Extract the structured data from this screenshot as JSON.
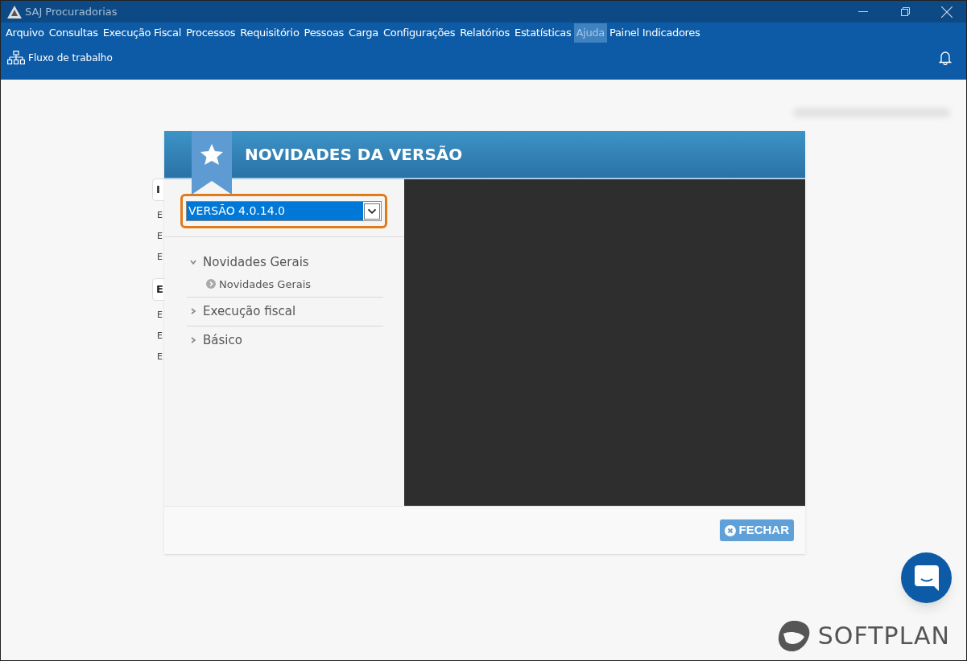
{
  "window": {
    "title": "SAJ Procuradorias"
  },
  "menu": [
    {
      "label": "Arquivo",
      "selected": false
    },
    {
      "label": "Consultas",
      "selected": false
    },
    {
      "label": "Execução Fiscal",
      "selected": false
    },
    {
      "label": "Processos",
      "selected": false
    },
    {
      "label": "Requisitório",
      "selected": false
    },
    {
      "label": "Pessoas",
      "selected": false
    },
    {
      "label": "Carga",
      "selected": false
    },
    {
      "label": "Configurações",
      "selected": false
    },
    {
      "label": "Relatórios",
      "selected": false
    },
    {
      "label": "Estatísticas",
      "selected": false
    },
    {
      "label": "Ajuda",
      "selected": true
    },
    {
      "label": "Painel Indicadores",
      "selected": false
    }
  ],
  "toolbar": {
    "workflow": "Fluxo de trabalho"
  },
  "background_cards": [
    {
      "heading": "I",
      "items": [
        "E",
        "E",
        "E"
      ]
    },
    {
      "heading": "E",
      "items": [
        "E",
        "E",
        "E"
      ]
    }
  ],
  "dialog": {
    "title": "NOVIDADES DA VERSÃO",
    "version_select": {
      "value": "VERSÃO 4.0.14.0"
    },
    "tree": [
      {
        "label": "Novidades Gerais",
        "expanded": true,
        "children": [
          {
            "label": "Novidades Gerais"
          }
        ]
      },
      {
        "label": "Execução fiscal",
        "expanded": false
      },
      {
        "label": "Básico",
        "expanded": false
      }
    ],
    "close_button": "FECHAR"
  },
  "brand": "SOFTPLAN"
}
